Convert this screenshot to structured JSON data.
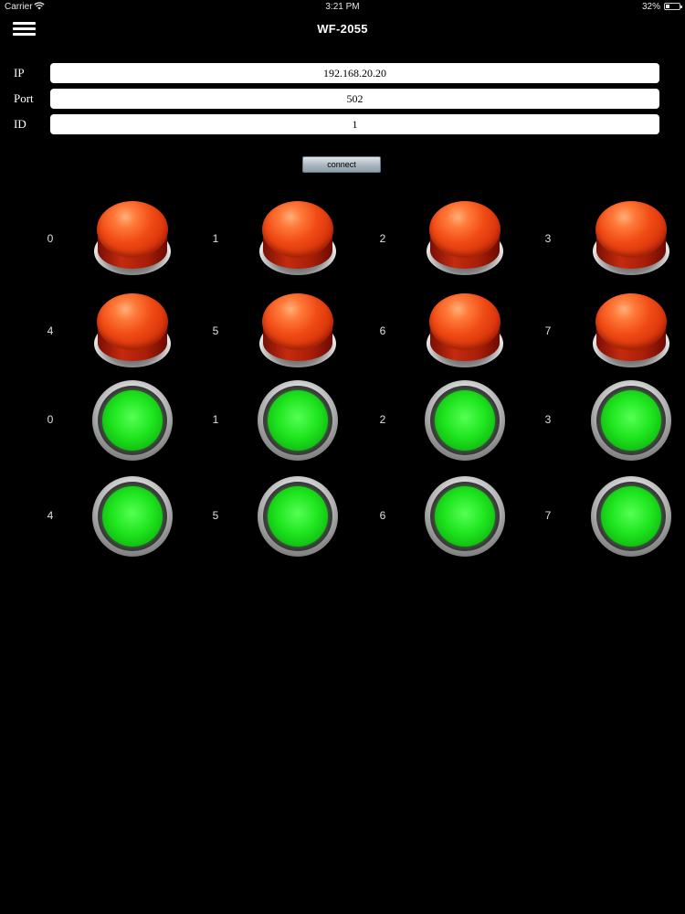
{
  "status_bar": {
    "carrier": "Carrier",
    "wifi_icon": "wifi-icon",
    "time": "3:21 PM",
    "battery_percent": "32%",
    "battery_level": 0.32
  },
  "nav": {
    "title": "WF-2055",
    "menu_icon": "hamburger-menu-icon"
  },
  "form": {
    "ip": {
      "label": "IP",
      "value": "192.168.20.20"
    },
    "port": {
      "label": "Port",
      "value": "502"
    },
    "id": {
      "label": "ID",
      "value": "1"
    }
  },
  "connect_label": "connect",
  "outputs": {
    "color": "#f04a14",
    "items": [
      {
        "label": "0"
      },
      {
        "label": "1"
      },
      {
        "label": "2"
      },
      {
        "label": "3"
      },
      {
        "label": "4"
      },
      {
        "label": "5"
      },
      {
        "label": "6"
      },
      {
        "label": "7"
      }
    ]
  },
  "inputs": {
    "color": "#1fe61f",
    "items": [
      {
        "label": "0"
      },
      {
        "label": "1"
      },
      {
        "label": "2"
      },
      {
        "label": "3"
      },
      {
        "label": "4"
      },
      {
        "label": "5"
      },
      {
        "label": "6"
      },
      {
        "label": "7"
      }
    ]
  }
}
